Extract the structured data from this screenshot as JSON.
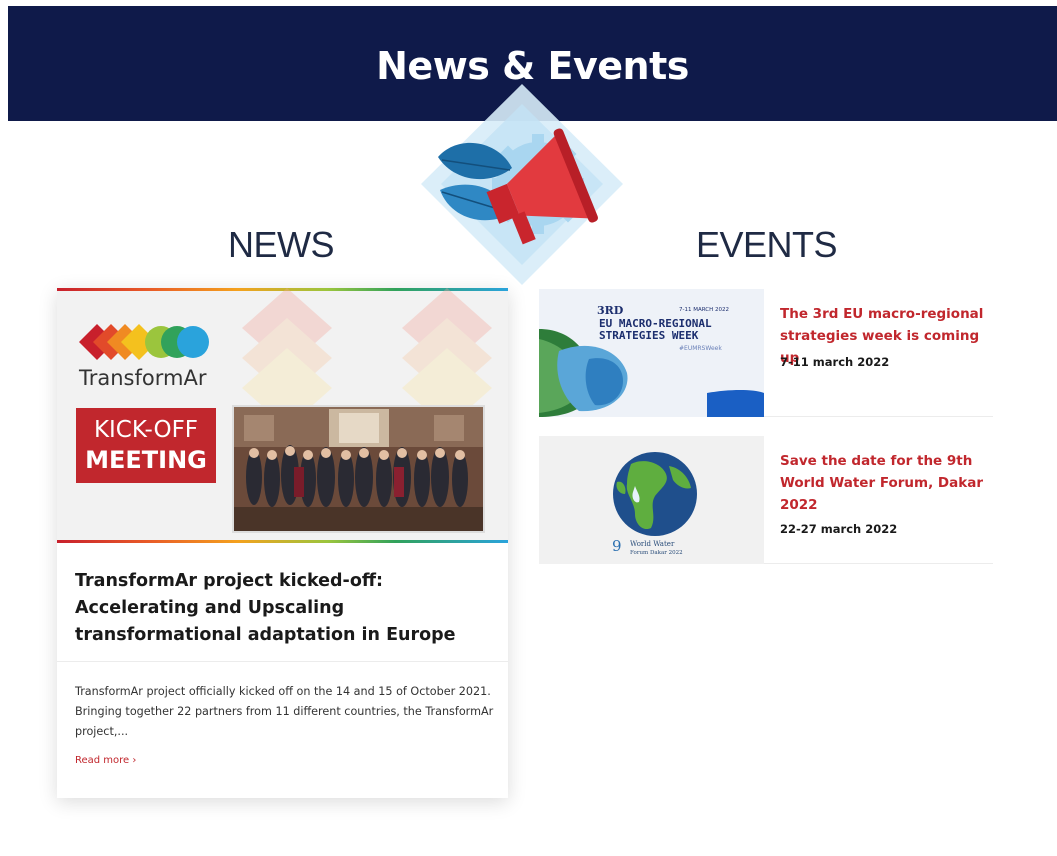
{
  "banner": {
    "title": "News & Events"
  },
  "sections": {
    "news": "NEWS",
    "events": "EVENTS"
  },
  "hero": {
    "icon": "megaphone-leaf-gear-icon"
  },
  "news": {
    "image": {
      "logo_text": "TransformAr",
      "badge_line1": "KICK-OFF",
      "badge_line2": "MEETING"
    },
    "headline": "TransformAr project kicked-off: Accelerating and Upscaling transformational adaptation in Europe",
    "excerpt": "TransformAr project officially kicked off on the 14 and 15 of October 2021. Bringing together 22 partners from 11 different countries, the TransformAr project,...",
    "read_more": "Read more ›"
  },
  "events": [
    {
      "thumb": {
        "ordinal": "3RD",
        "dates": "7-11 MARCH 2022",
        "line1": "EU MACRO-REGIONAL",
        "line2": "STRATEGIES WEEK",
        "hashtag": "#EUMRSWeek"
      },
      "title": "The 3rd EU macro-regional strategies week is coming up",
      "date": "7-11 march 2022"
    },
    {
      "thumb": {
        "number": "9",
        "line1": "World Water",
        "line2": "Forum Dakar 2022"
      },
      "title": "Save the date for the 9th World Water Forum, Dakar 2022",
      "date": "22-27 march 2022"
    }
  ],
  "colors": {
    "banner": "#0f1a4a",
    "accent_red": "#c1272d",
    "heading": "#1f2a44"
  }
}
